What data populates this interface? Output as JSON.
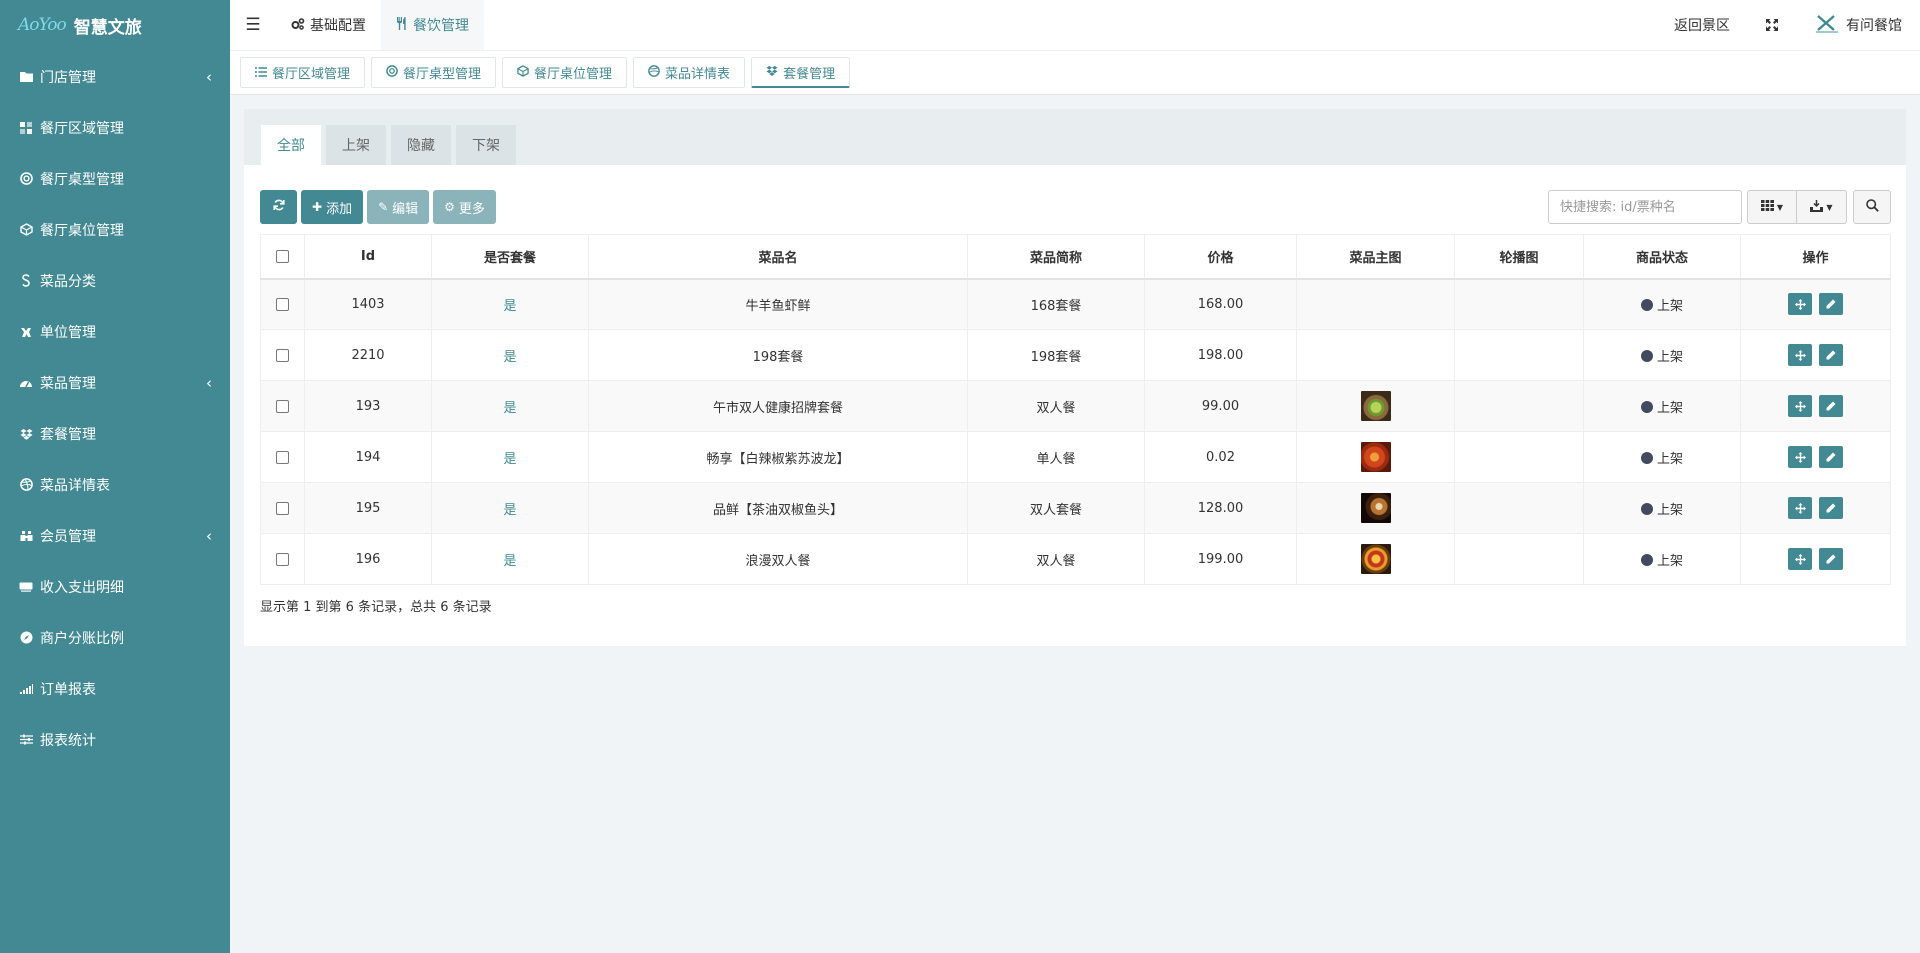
{
  "brand": {
    "logo_text": "AoYoo",
    "title": "智慧文旅"
  },
  "sidebar": {
    "items": [
      {
        "label": "门店管理",
        "icon": "folder-icon",
        "has_children": true
      },
      {
        "label": "餐厅区域管理",
        "icon": "grid-icon",
        "has_children": false
      },
      {
        "label": "餐厅桌型管理",
        "icon": "lifebuoy-icon",
        "has_children": false
      },
      {
        "label": "餐厅桌位管理",
        "icon": "cube-icon",
        "has_children": false
      },
      {
        "label": "菜品分类",
        "icon": "strikethrough-icon",
        "has_children": false
      },
      {
        "label": "单位管理",
        "icon": "ravelry-icon",
        "has_children": false
      },
      {
        "label": "菜品管理",
        "icon": "dashboard-icon",
        "has_children": true
      },
      {
        "label": "套餐管理",
        "icon": "dropbox-icon",
        "has_children": false
      },
      {
        "label": "菜品详情表",
        "icon": "dribbble-icon",
        "has_children": false
      },
      {
        "label": "会员管理",
        "icon": "binoculars-icon",
        "has_children": true
      },
      {
        "label": "收入支出明细",
        "icon": "keyboard-icon",
        "has_children": false
      },
      {
        "label": "商户分账比例",
        "icon": "compass-icon",
        "has_children": false
      },
      {
        "label": "订单报表",
        "icon": "signal-icon",
        "has_children": false
      },
      {
        "label": "报表统计",
        "icon": "sliders-icon",
        "has_children": false
      }
    ]
  },
  "header": {
    "nav": [
      {
        "label": "基础配置",
        "icon": "cogs-icon",
        "active": false
      },
      {
        "label": "餐饮管理",
        "icon": "cutlery-icon",
        "active": true
      }
    ],
    "back_label": "返回景区",
    "user_name": "有问餐馆"
  },
  "subtabs": [
    {
      "label": "餐厅区域管理",
      "icon": "list-icon",
      "active": false
    },
    {
      "label": "餐厅桌型管理",
      "icon": "lifebuoy-icon",
      "active": false
    },
    {
      "label": "餐厅桌位管理",
      "icon": "cube-icon",
      "active": false
    },
    {
      "label": "菜品详情表",
      "icon": "dribbble-icon",
      "active": false
    },
    {
      "label": "套餐管理",
      "icon": "dropbox-icon",
      "active": true
    }
  ],
  "filter_tabs": [
    {
      "label": "全部",
      "active": true
    },
    {
      "label": "上架",
      "active": false
    },
    {
      "label": "隐藏",
      "active": false
    },
    {
      "label": "下架",
      "active": false
    }
  ],
  "toolbar": {
    "add_label": "添加",
    "edit_label": "编辑",
    "more_label": "更多"
  },
  "search": {
    "placeholder": "快捷搜索: id/票种名"
  },
  "table": {
    "columns": [
      "Id",
      "是否套餐",
      "菜品名",
      "菜品简称",
      "价格",
      "菜品主图",
      "轮播图",
      "商品状态",
      "操作"
    ],
    "rows": [
      {
        "id": "1403",
        "is_combo": "是",
        "name": "牛羊鱼虾鲜",
        "short": "168套餐",
        "price": "168.00",
        "image": "",
        "carousel": "",
        "status": "上架"
      },
      {
        "id": "2210",
        "is_combo": "是",
        "name": "198套餐",
        "short": "198套餐",
        "price": "198.00",
        "image": "",
        "carousel": "",
        "status": "上架"
      },
      {
        "id": "193",
        "is_combo": "是",
        "name": "午市双人健康招牌套餐",
        "short": "双人餐",
        "price": "99.00",
        "image": "salad-photo",
        "carousel": "",
        "status": "上架"
      },
      {
        "id": "194",
        "is_combo": "是",
        "name": "畅享【白辣椒紫苏波龙】",
        "short": "单人餐",
        "price": "0.02",
        "image": "lobster-photo",
        "carousel": "",
        "status": "上架"
      },
      {
        "id": "195",
        "is_combo": "是",
        "name": "品鲜【茶油双椒鱼头】",
        "short": "双人套餐",
        "price": "128.00",
        "image": "fishhead-photo",
        "carousel": "",
        "status": "上架"
      },
      {
        "id": "196",
        "is_combo": "是",
        "name": "浪漫双人餐",
        "short": "双人餐",
        "price": "199.00",
        "image": "platter-photo",
        "carousel": "",
        "status": "上架"
      }
    ]
  },
  "pagination": {
    "info": "显示第 1 到第 6 条记录，总共 6 条记录"
  },
  "colors": {
    "primary": "#438993",
    "sidebar_bg": "#438993",
    "disabled": "#8bb4ba",
    "status_dot": "#424a5f"
  }
}
